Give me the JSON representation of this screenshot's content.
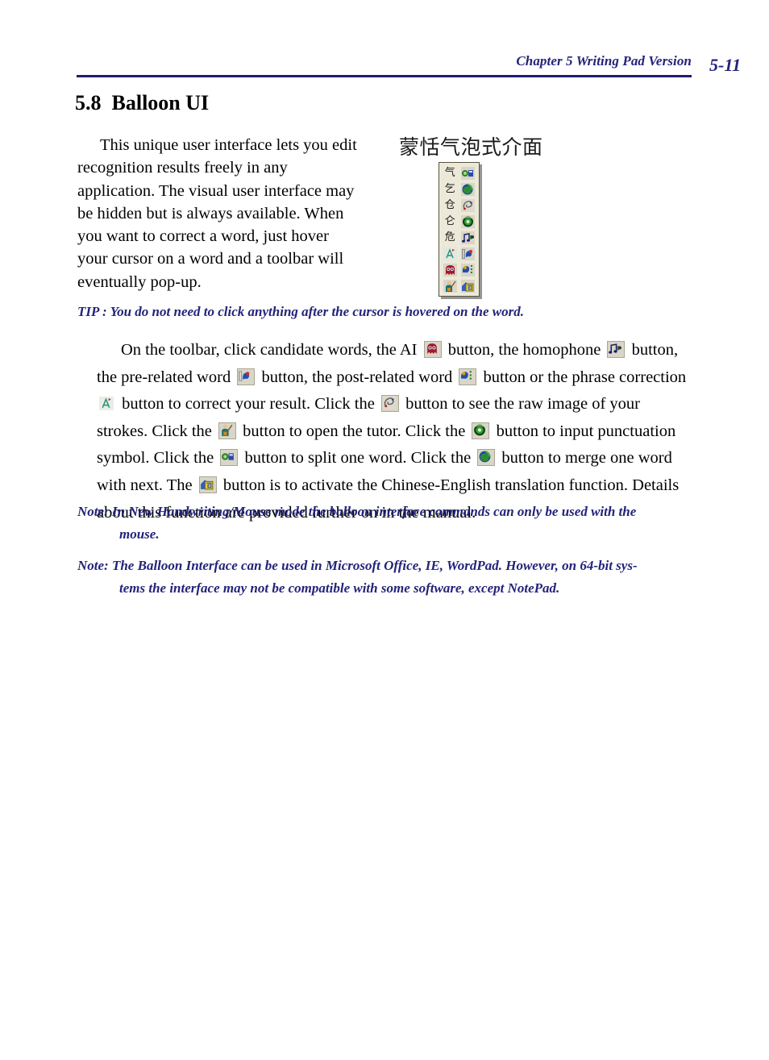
{
  "document": {
    "header": {
      "chapter_title": "Chapter 5 Writing Pad Version",
      "page_number": "5-11",
      "rule_color": "#1d1d6e",
      "text_color": "#23237a"
    },
    "section": {
      "number": "5.8",
      "title": "Balloon UI"
    },
    "intro_paragraph": "This unique user interface lets you edit recognition results freely in any application. The visual user interface may be hidden but is always available. When you want to correct a word, just hover your cursor on a word and a toolbar will eventually pop-up.",
    "figure": {
      "caption": "蒙恬气泡式介面",
      "toolbar": {
        "background_color": "#ece9d9",
        "border_color": "#56543f",
        "rows": [
          {
            "left": {
              "type": "candidate-char",
              "label": "气"
            },
            "right": {
              "type": "icon",
              "name": "pre-related-word-icon"
            }
          },
          {
            "left": {
              "type": "candidate-char",
              "label": "乞"
            },
            "right": {
              "type": "icon",
              "name": "merge-word-icon"
            }
          },
          {
            "left": {
              "type": "candidate-char",
              "label": "仓"
            },
            "right": {
              "type": "icon",
              "name": "raw-image-icon"
            }
          },
          {
            "left": {
              "type": "candidate-char",
              "label": "仑"
            },
            "right": {
              "type": "icon",
              "name": "punctuation-icon"
            }
          },
          {
            "left": {
              "type": "candidate-char",
              "label": "危"
            },
            "right": {
              "type": "icon",
              "name": "homophone-icon"
            }
          },
          {
            "left": {
              "type": "icon",
              "name": "phrase-correction-icon"
            },
            "right": {
              "type": "icon",
              "name": "split-word-icon"
            }
          },
          {
            "left": {
              "type": "icon",
              "name": "ai-icon"
            },
            "right": {
              "type": "icon",
              "name": "post-related-word-icon"
            }
          },
          {
            "left": {
              "type": "icon",
              "name": "tutor-icon"
            },
            "right": {
              "type": "icon",
              "name": "translation-icon"
            }
          }
        ]
      }
    },
    "tip": "TIP : You do not need to click anything after the cursor is hovered on the word.",
    "body_paragraph": {
      "seg1": "On the toolbar, click candidate words,  the AI ",
      "seg2": " button, the homophone ",
      "seg3": " button, the pre-related word ",
      "seg4": " button, the post-related word ",
      "seg5": " button or the phrase correction ",
      "seg6": " button to correct your result. Click the ",
      "seg7": " button to see the raw image of your strokes. Click the ",
      "seg8": " button to open the tutor. Click the ",
      "seg9": " button to input punctuation symbol. Click the ",
      "seg10": " button to split one word. Click the ",
      "seg11": " button to merge one word with next. The ",
      "seg12": " button is to activate the Chinese-English translation function. Details about this function are provided further on in the manual."
    },
    "notes": [
      {
        "label": "Note: ",
        "line1": "In New Handwriting/Mouse mode the balloon interface commands can only be used with the",
        "line2": "mouse."
      },
      {
        "label": "Note: ",
        "line1": "The Balloon Interface can be used in Microsoft Office, IE, WordPad. However, on 64-bit sys-",
        "line2": "tems the interface may not be compatible with some software, except NotePad."
      }
    ]
  }
}
